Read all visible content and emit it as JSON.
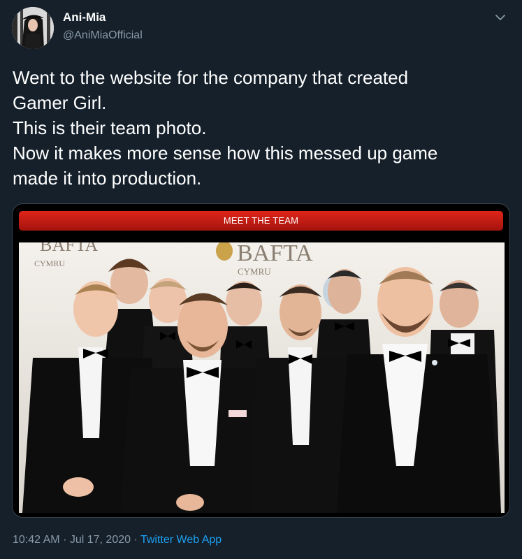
{
  "user": {
    "name": "Ani-Mia",
    "handle": "@AniMiaOfficial"
  },
  "tweet": {
    "lines": [
      "Went to the website for the company that created",
      "Gamer Girl.",
      "This is their team photo.",
      "Now it makes more sense how this messed up game",
      "made it into production."
    ]
  },
  "media": {
    "banner": "MEET THE TEAM",
    "backdrop_left": "BAFTA",
    "backdrop_left_sub": "CYMRU",
    "backdrop_center": "BAFTA",
    "backdrop_center_sub": "CYMRU"
  },
  "footer": {
    "time": "10:42 AM",
    "separator": "·",
    "date": "Jul 17, 2020",
    "source": "Twitter Web App"
  },
  "icons": {
    "caret": "chevron-down-icon"
  },
  "colors": {
    "background": "#15202b",
    "secondary_text": "#8899a6",
    "link": "#1da1f2",
    "banner_red": "#d11f16"
  }
}
